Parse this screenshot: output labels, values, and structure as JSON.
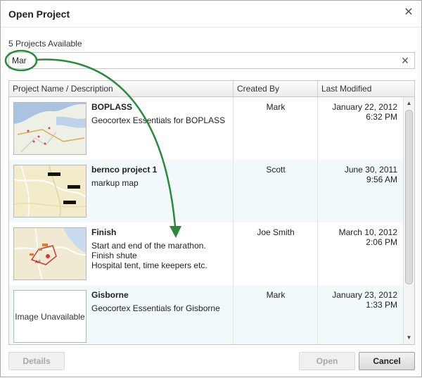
{
  "dialog": {
    "title": "Open Project",
    "projects_available": "5 Projects Available"
  },
  "search": {
    "value": "Mar",
    "placeholder": ""
  },
  "table": {
    "headers": [
      "Project Name / Description",
      "Created By",
      "Last Modified"
    ],
    "rows": [
      {
        "name": "BOPLASS",
        "description": "Geocortex Essentials for BOPLASS",
        "created_by": "Mark",
        "date": "January 22, 2012",
        "time": "6:32 PM",
        "thumbnail": "map-thumbnail"
      },
      {
        "name": "bernco project 1",
        "description": "markup map",
        "created_by": "Scott",
        "date": "June 30, 2011",
        "time": "9:56 AM",
        "thumbnail": "map-thumbnail"
      },
      {
        "name": "Finish",
        "description": "Start and end of the marathon.\nFinish shute\nHospital tent, time keepers etc.",
        "created_by": "Joe Smith",
        "date": "March 10, 2012",
        "time": "2:06 PM",
        "thumbnail": "map-thumbnail"
      },
      {
        "name": "Gisborne",
        "description": "Geocortex Essentials for Gisborne",
        "created_by": "Mark",
        "date": "January 23, 2012",
        "time": "1:33 PM",
        "thumbnail_text": "Image Unavailable"
      }
    ]
  },
  "buttons": {
    "details": "Details",
    "open": "Open",
    "cancel": "Cancel"
  },
  "icons": {
    "close": "close-icon",
    "clear": "clear-icon",
    "scroll_up": "arrow-up-icon",
    "scroll_down": "arrow-down-icon"
  },
  "colors": {
    "annotation": "#2a8a3a",
    "alt_row": "#f1f9fb"
  }
}
